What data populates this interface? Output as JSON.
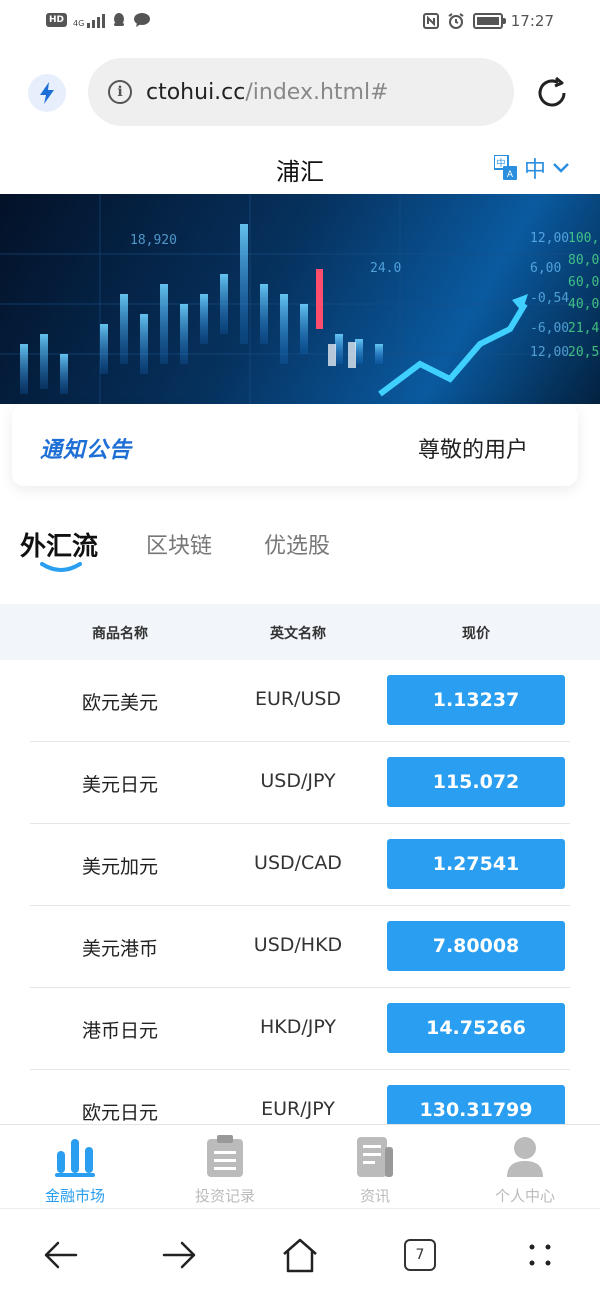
{
  "status_bar": {
    "network_badge": "HD",
    "network_type": "4G",
    "time": "17:27"
  },
  "browser": {
    "url_host": "ctohui.cc",
    "url_path": "/index.html#",
    "tab_count": "7"
  },
  "header": {
    "title": "浦汇",
    "language": "中"
  },
  "notice": {
    "logo_text": "通知公告",
    "text": "尊敬的用户"
  },
  "tabs": [
    {
      "label": "外汇流",
      "active": true
    },
    {
      "label": "区块链",
      "active": false
    },
    {
      "label": "优选股",
      "active": false
    }
  ],
  "table": {
    "headers": {
      "name": "商品名称",
      "english": "英文名称",
      "price": "现价"
    },
    "rows": [
      {
        "name": "欧元美元",
        "english": "EUR/USD",
        "price": "1.13237"
      },
      {
        "name": "美元日元",
        "english": "USD/JPY",
        "price": "115.072"
      },
      {
        "name": "美元加元",
        "english": "USD/CAD",
        "price": "1.27541"
      },
      {
        "name": "美元港币",
        "english": "USD/HKD",
        "price": "7.80008"
      },
      {
        "name": "港币日元",
        "english": "HKD/JPY",
        "price": "14.75266"
      },
      {
        "name": "欧元日元",
        "english": "EUR/JPY",
        "price": "130.31799"
      }
    ]
  },
  "bottom_nav": [
    {
      "label": "金融市场",
      "icon": "bar-chart-icon",
      "active": true
    },
    {
      "label": "投资记录",
      "icon": "clipboard-icon",
      "active": false
    },
    {
      "label": "资讯",
      "icon": "news-icon",
      "active": false
    },
    {
      "label": "个人中心",
      "icon": "user-icon",
      "active": false
    }
  ],
  "colors": {
    "accent": "#2a9ef0",
    "price_button": "#2a9ef0",
    "nav_inactive": "#bbbbbb",
    "lang_blue": "#2b8fe0"
  }
}
